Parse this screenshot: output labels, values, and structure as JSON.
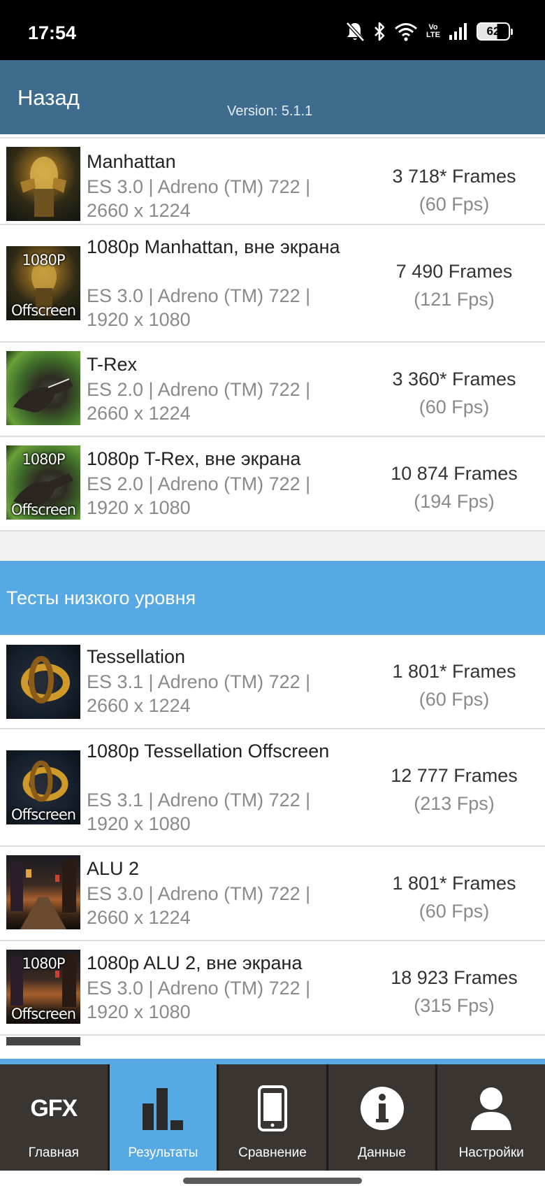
{
  "status_bar": {
    "time": "17:54",
    "battery": "62",
    "network_badge_top": "Vo",
    "network_badge_bottom": "LTE"
  },
  "header": {
    "back_label": "Назад",
    "version": "Version: 5.1.1",
    "color": "#3d6c8e"
  },
  "results": [
    {
      "thumb": "manhattan",
      "thumb_top": "",
      "thumb_bottom": "",
      "name": "Manhattan",
      "details": "ES 3.0 | Adreno (TM) 722 | 2660 x 1224",
      "frames": "3 718* Frames",
      "fps": "(60 Fps)"
    },
    {
      "thumb": "manhattan",
      "thumb_top": "1080P",
      "thumb_bottom": "Offscreen",
      "name": "1080p Manhattan, вне экрана",
      "details": "ES 3.0 | Adreno (TM) 722 | 1920 x 1080",
      "frames": "7 490 Frames",
      "fps": "(121 Fps)"
    },
    {
      "thumb": "trex",
      "thumb_top": "",
      "thumb_bottom": "",
      "name": "T-Rex",
      "details": "ES 2.0 | Adreno (TM) 722 | 2660 x 1224",
      "frames": "3 360* Frames",
      "fps": "(60 Fps)"
    },
    {
      "thumb": "trex",
      "thumb_top": "1080P",
      "thumb_bottom": "Offscreen",
      "name": "1080p T-Rex, вне экрана",
      "details": "ES 2.0 | Adreno (TM) 722 | 1920 x 1080",
      "frames": "10 874 Frames",
      "fps": "(194 Fps)"
    }
  ],
  "section": {
    "title": "Тесты низкого уровня",
    "color": "#57a9e3"
  },
  "low_level": [
    {
      "thumb": "tess",
      "thumb_top": "",
      "thumb_bottom": "",
      "name": "Tessellation",
      "details": "ES 3.1 | Adreno (TM) 722 | 2660 x 1224",
      "frames": "1 801* Frames",
      "fps": "(60 Fps)"
    },
    {
      "thumb": "tess",
      "thumb_top": "",
      "thumb_bottom": "Offscreen",
      "name": "1080p Tessellation Offscreen",
      "details": "ES 3.1 | Adreno (TM) 722 | 1920 x 1080",
      "frames": "12 777 Frames",
      "fps": "(213 Fps)"
    },
    {
      "thumb": "alu",
      "thumb_top": "",
      "thumb_bottom": "",
      "name": "ALU 2",
      "details": "ES 3.0 | Adreno (TM) 722 | 2660 x 1224",
      "frames": "1 801* Frames",
      "fps": "(60 Fps)"
    },
    {
      "thumb": "alu",
      "thumb_top": "1080P",
      "thumb_bottom": "Offscreen",
      "name": "1080p ALU 2, вне экрана",
      "details": "ES 3.0 | Adreno (TM) 722 | 1920 x 1080",
      "frames": "18 923 Frames",
      "fps": "(315 Fps)"
    }
  ],
  "bottom_nav": {
    "items": [
      {
        "label": "Главная",
        "icon": "gfx-logo-icon",
        "icon_text": "GFX",
        "active": false
      },
      {
        "label": "Результаты",
        "icon": "bar-chart-icon",
        "active": true
      },
      {
        "label": "Сравнение",
        "icon": "phone-icon",
        "active": false
      },
      {
        "label": "Данные",
        "icon": "info-icon",
        "active": false
      },
      {
        "label": "Настройки",
        "icon": "user-icon",
        "active": false
      }
    ],
    "active_color": "#57a9e3"
  }
}
